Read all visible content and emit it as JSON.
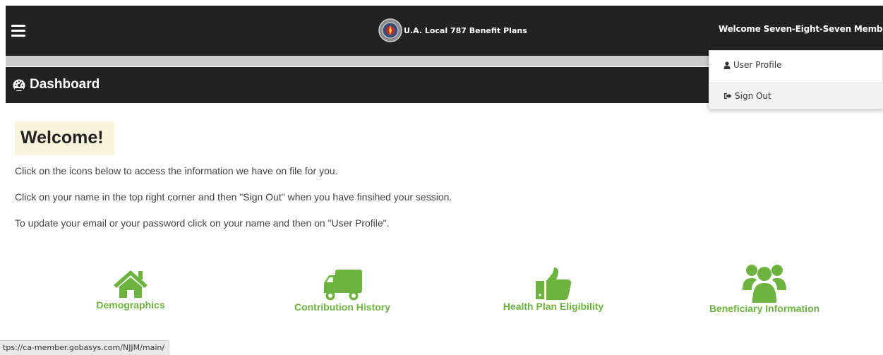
{
  "header": {
    "brand": "U.A. Local 787 Benefit Plans",
    "user_menu": "Welcome Seven-Eight-Seven Member"
  },
  "user_dropdown": {
    "profile": "User Profile",
    "signout": "Sign Out"
  },
  "page": {
    "title": "Dashboard"
  },
  "welcome": {
    "heading": "Welcome!",
    "lines": [
      "Click on the icons below to access the information we have on file for you.",
      "Click on your name in the top right corner and then \"Sign Out\" when you have finsihed your session.",
      "To update your email or your password click on your name and then on \"User Profile\"."
    ]
  },
  "tiles": [
    {
      "label": "Demographics",
      "icon": "home-icon"
    },
    {
      "label": "Contribution History",
      "icon": "truck-icon"
    },
    {
      "label": "Health Plan Eligibility",
      "icon": "thumbs-up-icon"
    },
    {
      "label": "Beneficiary Information",
      "icon": "users-icon"
    }
  ],
  "status_bar": {
    "url": "tps://ca-member.gobasys.com/NJJM/main/"
  },
  "colors": {
    "nav_bg": "#222222",
    "accent_green": "#6cb33f",
    "welcome_bg": "#fcf3dd"
  }
}
